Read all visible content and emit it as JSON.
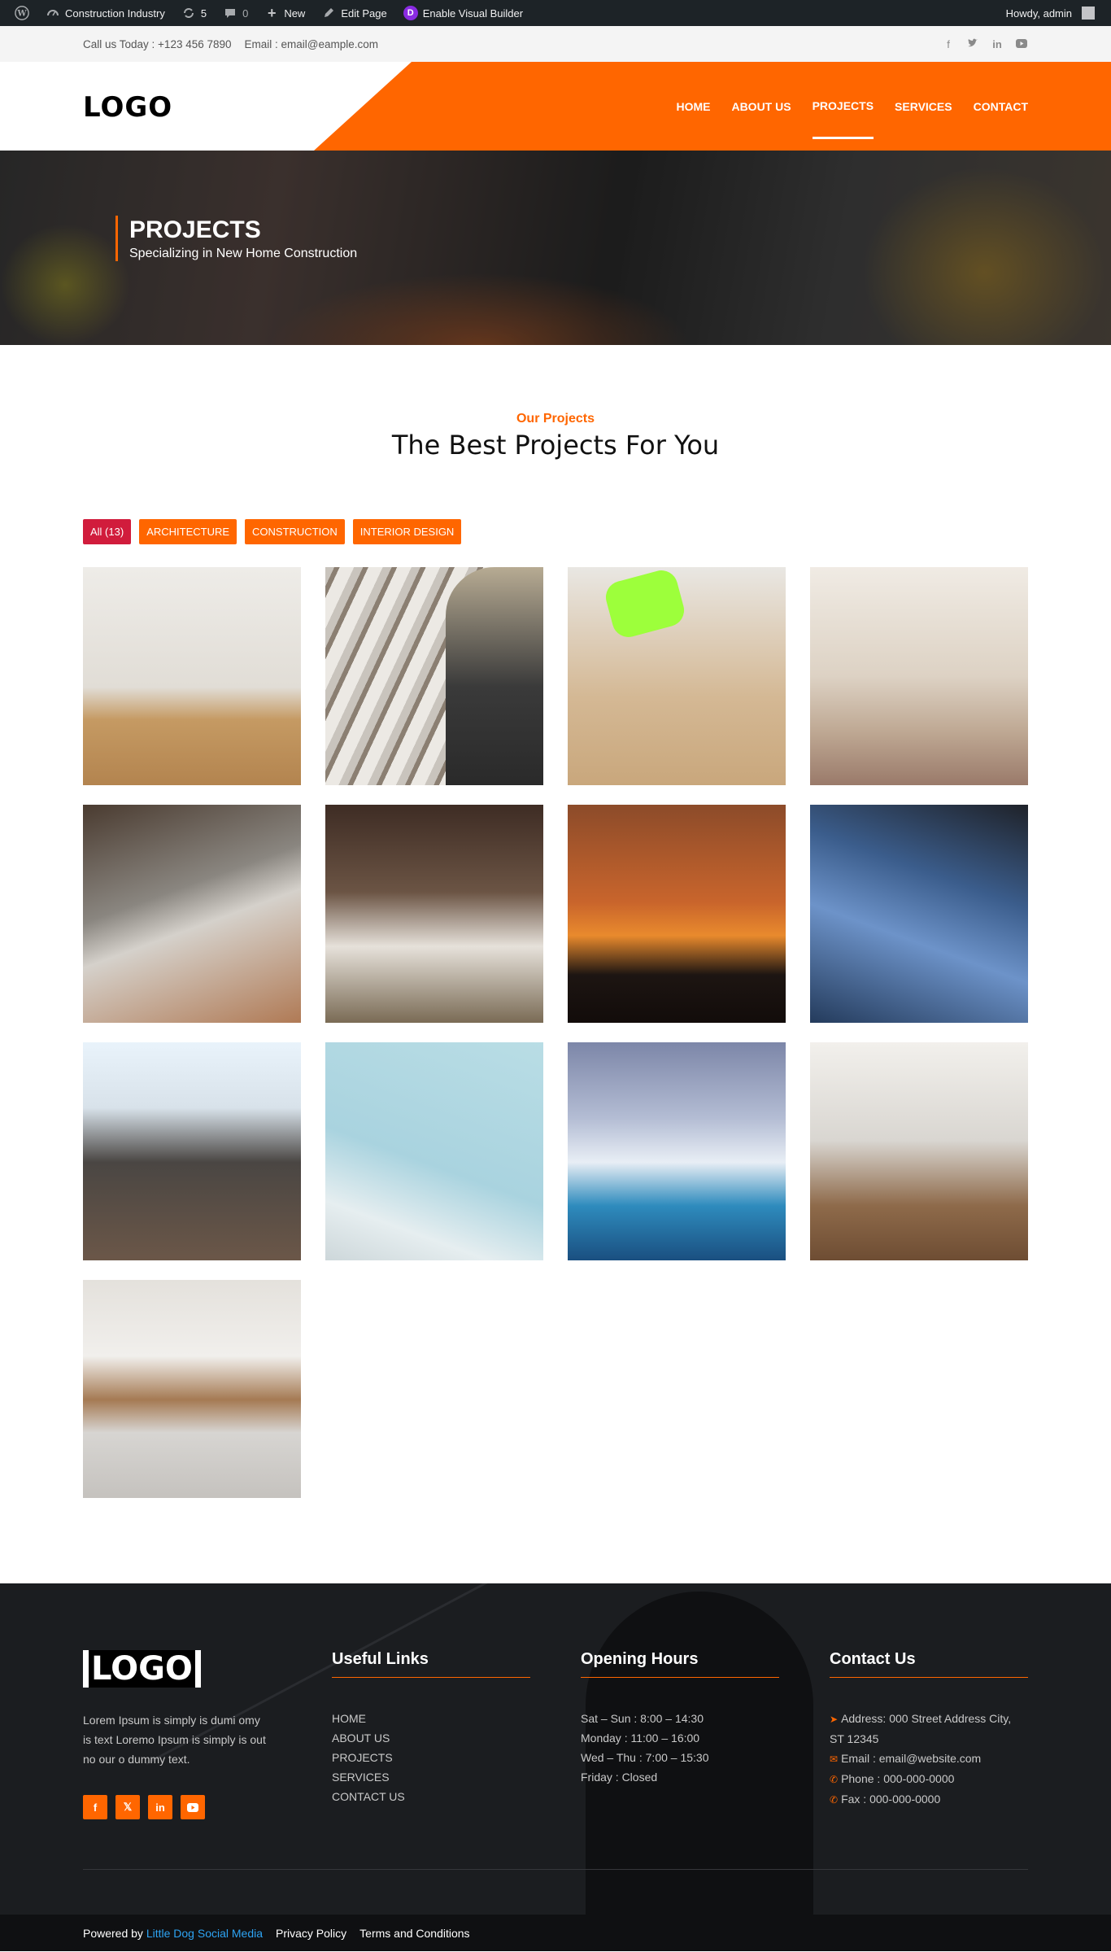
{
  "adminbar": {
    "site_name": "Construction Industry",
    "updates_count": "5",
    "comments_count": "0",
    "new_label": "New",
    "edit_label": "Edit Page",
    "builder_label": "Enable Visual Builder",
    "greeting": "Howdy, admin"
  },
  "topbar": {
    "phone": "Call us Today : +123 456 7890",
    "email": "Email : email@eample.com"
  },
  "header": {
    "logo": "LOGO",
    "nav": [
      "HOME",
      "ABOUT US",
      "PROJECTS",
      "SERVICES",
      "CONTACT"
    ],
    "active_nav": "PROJECTS"
  },
  "hero": {
    "title": "PROJECTS",
    "subtitle": "Specializing in New Home Construction"
  },
  "section": {
    "eyebrow": "Our Projects",
    "heading": "The Best Projects For You"
  },
  "filters": [
    "All (13)",
    "ARCHITECTURE",
    "CONSTRUCTION",
    "INTERIOR DESIGN"
  ],
  "footer": {
    "logo": "LOGO",
    "about": "Lorem Ipsum is simply is dumi omy is text Loremo Ipsum is simply is out no our o dummy text.",
    "useful_links": {
      "title": "Useful Links",
      "items": [
        "HOME",
        "ABOUT US",
        "PROJECTS",
        "SERVICES",
        "CONTACT US"
      ]
    },
    "opening_hours": {
      "title": "Opening Hours",
      "items": [
        "Sat – Sun : 8:00 – 14:30",
        "Monday : 11:00 – 16:00",
        "Wed – Thu : 7:00 – 15:30",
        "Friday : Closed"
      ]
    },
    "contact": {
      "title": "Contact Us",
      "address": "Address: 000 Street Address City, ST 12345",
      "email": "Email : email@website.com",
      "phone": "Phone : 000-000-0000",
      "fax": "Fax : 000-000-0000"
    },
    "powered_prefix": "Powered by",
    "powered_brand": "Little Dog Social Media",
    "privacy": "Privacy Policy",
    "terms": "Terms and Conditions"
  },
  "colors": {
    "accent": "#ff6600",
    "active_filter": "#d11c3c",
    "adminbar": "#1d2327",
    "footer": "#1b1d20"
  }
}
